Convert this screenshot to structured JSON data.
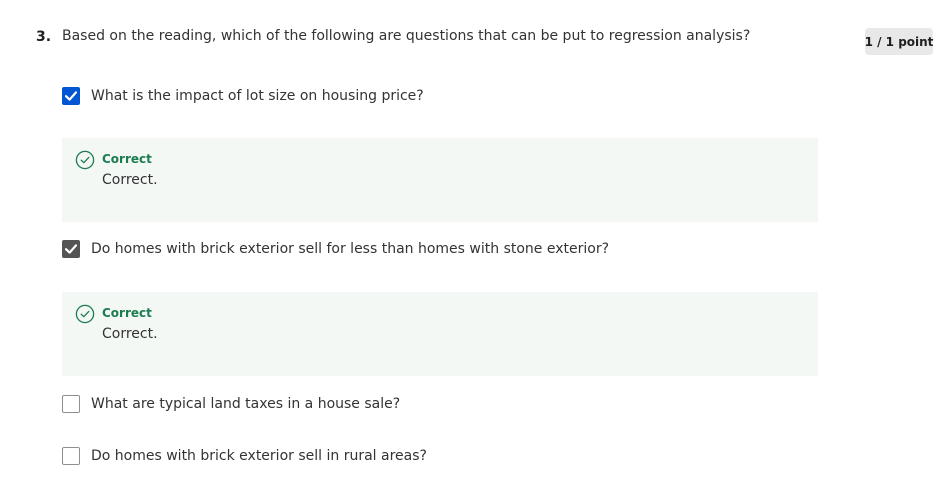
{
  "question": {
    "number": "3.",
    "text": "Based on the reading, which of the following are questions that can be put to regression analysis?",
    "score": "1 / 1 point"
  },
  "options": [
    {
      "label": "What is the impact of lot size on housing price?",
      "checked": true,
      "feedback": {
        "title": "Correct",
        "body": "Correct."
      }
    },
    {
      "label": "Do homes with brick exterior sell for less than homes with stone exterior?",
      "checked": true,
      "feedback": {
        "title": "Correct",
        "body": "Correct."
      }
    },
    {
      "label": "What are typical land taxes in a house sale?",
      "checked": false
    },
    {
      "label": "Do homes with brick exterior sell in rural areas?",
      "checked": false
    }
  ],
  "colors": {
    "checkbox_primary": "#0056d2",
    "checkbox_secondary": "#545454",
    "correct_green": "#1d7c50",
    "feedback_bg": "#f3f8f5",
    "badge_bg": "#e8e8e8"
  },
  "icons": {
    "check": "check-icon",
    "feedback": "check-circle-icon"
  }
}
